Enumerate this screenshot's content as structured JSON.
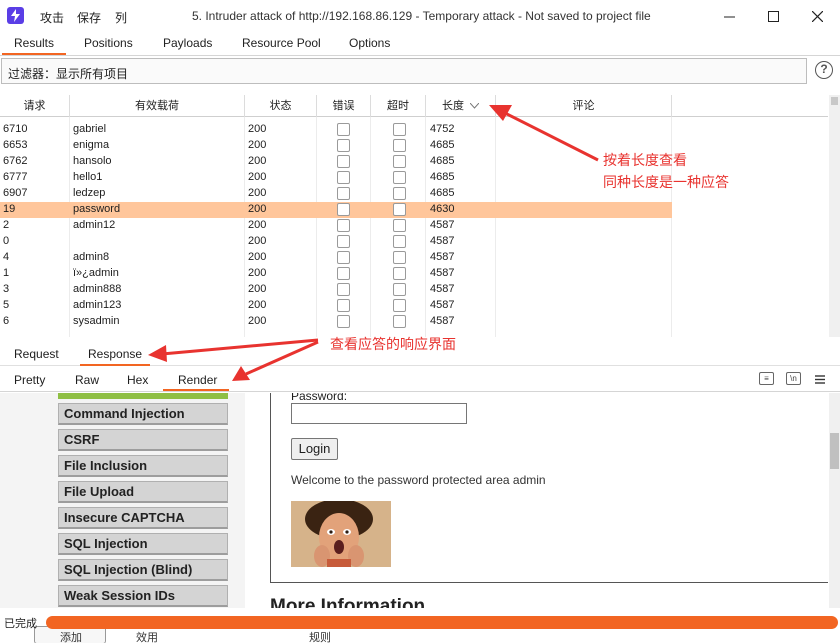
{
  "window": {
    "menu": [
      "攻击",
      "保存",
      "列"
    ],
    "title": "5. Intruder attack of http://192.168.86.129 - Temporary attack - Not saved to project file"
  },
  "tabs": [
    "Results",
    "Positions",
    "Payloads",
    "Resource Pool",
    "Options"
  ],
  "filter": {
    "text": "过滤器：显示所有项目",
    "help": "?"
  },
  "table": {
    "columns": [
      "请求",
      "有效载荷",
      "状态",
      "错误",
      "超时",
      "长度",
      "评论"
    ],
    "rows": [
      {
        "request": "6710",
        "payload": "gabriel",
        "status": "200",
        "length": "4752"
      },
      {
        "request": "6653",
        "payload": "enigma",
        "status": "200",
        "length": "4685"
      },
      {
        "request": "6762",
        "payload": "hansolo",
        "status": "200",
        "length": "4685"
      },
      {
        "request": "6777",
        "payload": "hello1",
        "status": "200",
        "length": "4685"
      },
      {
        "request": "6907",
        "payload": "ledzep",
        "status": "200",
        "length": "4685"
      },
      {
        "request": "19",
        "payload": "password",
        "status": "200",
        "length": "4630"
      },
      {
        "request": "2",
        "payload": "admin12",
        "status": "200",
        "length": "4587"
      },
      {
        "request": "0",
        "payload": "",
        "status": "200",
        "length": "4587"
      },
      {
        "request": "4",
        "payload": "admin8",
        "status": "200",
        "length": "4587"
      },
      {
        "request": "1",
        "payload": "ï»¿admin",
        "status": "200",
        "length": "4587"
      },
      {
        "request": "3",
        "payload": "admin888",
        "status": "200",
        "length": "4587"
      },
      {
        "request": "5",
        "payload": "admin123",
        "status": "200",
        "length": "4587"
      },
      {
        "request": "6",
        "payload": "sysadmin",
        "status": "200",
        "length": "4587"
      }
    ],
    "selected_index": 5,
    "selected_color": "#ffc69b"
  },
  "rr_tabs": [
    "Request",
    "Response"
  ],
  "view_tabs": [
    "Pretty",
    "Raw",
    "Hex",
    "Render"
  ],
  "render": {
    "menu": [
      "Command Injection",
      "CSRF",
      "File Inclusion",
      "File Upload",
      "Insecure CAPTCHA",
      "SQL Injection",
      "SQL Injection (Blind)",
      "Weak Session IDs"
    ],
    "password_label": "Password:",
    "login_button": "Login",
    "welcome": "Welcome to the password protected area admin",
    "more_info": "More Information"
  },
  "status": {
    "text": "已完成",
    "progress": 1.0,
    "bottom_labels": [
      "添加",
      "效用",
      "规则"
    ],
    "accent": "#f26522"
  },
  "annotations": {
    "length_note_1": "按着长度查看",
    "length_note_2": "同种长度是一种应答",
    "response_note": "查看应答的响应界面",
    "color": "#e8332f"
  }
}
